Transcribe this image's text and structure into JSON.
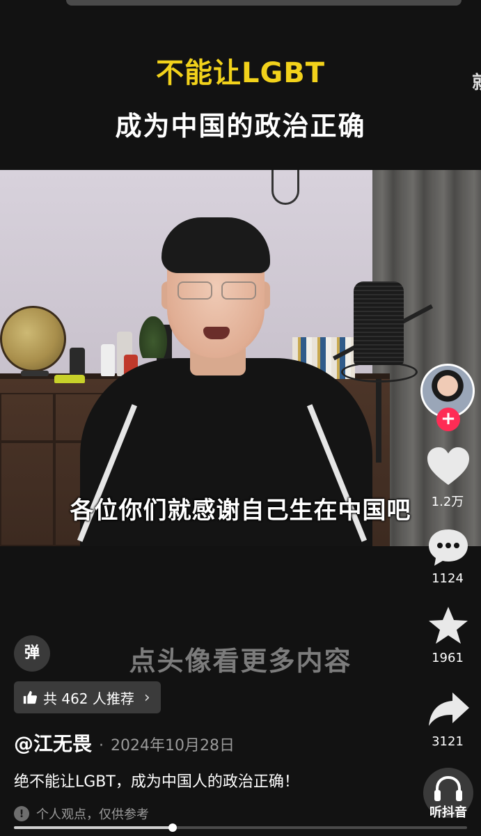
{
  "overlay": {
    "title_line1": "不能让LGBT",
    "title_line2": "成为中国的政治正确",
    "edge_char": "就",
    "subtitle": "各位你们就感谢自己生在中国吧",
    "more_hint": "点头像看更多内容"
  },
  "actions": {
    "follow_symbol": "+",
    "likes": "1.2万",
    "comments": "1124",
    "favorites": "1961",
    "shares": "3121",
    "listen_label": "听抖音"
  },
  "info": {
    "danmu_label": "弹",
    "recommend_text": "共 462 人推荐",
    "recommend_chevron": "›",
    "author": "@江无畏",
    "separator": "·",
    "date": "2024年10月28日",
    "description": "绝不能让LGBT，成为中国人的政治正确！",
    "disclaimer_icon": "!",
    "disclaimer": "个人观点，仅供参考"
  },
  "progress": {
    "fraction": 0.35
  },
  "colors": {
    "accent_yellow": "#f2d21b",
    "follow_red": "#fe2c55",
    "background": "#121212"
  },
  "icons": [
    "heart-icon",
    "comment-icon",
    "star-icon",
    "share-icon",
    "headphones-icon",
    "thumbs-up-icon",
    "alert-icon"
  ]
}
